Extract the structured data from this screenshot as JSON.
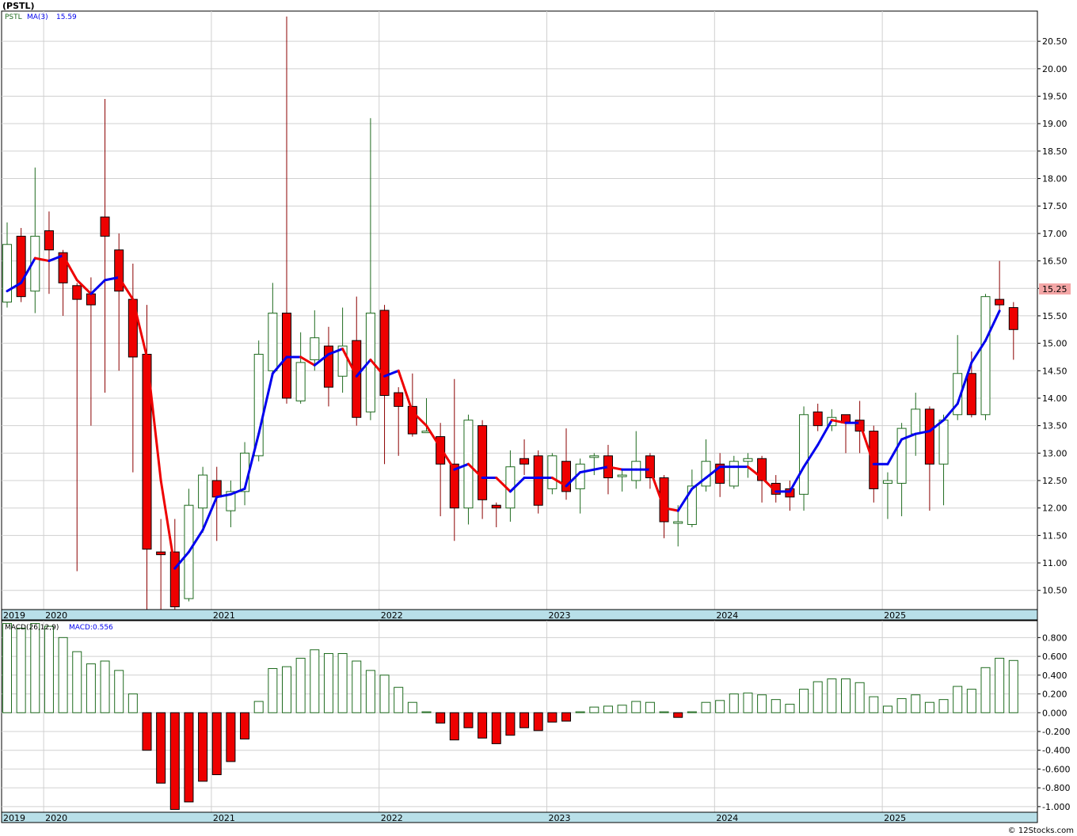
{
  "symbol_title": "(PSTL)",
  "legend": {
    "ticker": "PSTL",
    "ma_label": "MA(3)",
    "ma_value": "15.59",
    "macd_label": "MACD(26,12,9)",
    "macd_value": "MACD:0.556"
  },
  "last_price_label": "15.25",
  "watermark": "© 12Stocks.com",
  "colors": {
    "up": "#1f6b1f",
    "down": "#ee0000",
    "ma_up": "#0000ee",
    "ma_down": "#ee0000",
    "axis_band": "#b8dfe8",
    "grid": "#d0d0d0",
    "price_tag": "#f4a6a6"
  },
  "chart_data": [
    {
      "type": "candlestick",
      "title": "(PSTL)",
      "period": "monthly",
      "ylim": [
        10.15,
        21.05
      ],
      "y_ticks": [
        "10.50",
        "11.00",
        "11.50",
        "12.00",
        "12.50",
        "13.00",
        "13.50",
        "14.00",
        "14.50",
        "15.00",
        "15.50",
        "16.00",
        "16.50",
        "17.00",
        "17.50",
        "18.00",
        "18.50",
        "19.00",
        "19.50",
        "20.00",
        "20.50"
      ],
      "x_labels": [
        "2019",
        "2020",
        "2021",
        "2022",
        "2023",
        "2024",
        "2025"
      ],
      "year_starts": [
        0,
        3,
        15,
        27,
        39,
        51,
        63
      ],
      "candles": [
        [
          15.75,
          16.8,
          15.65,
          17.2
        ],
        [
          16.95,
          15.85,
          15.75,
          17.1
        ],
        [
          15.95,
          16.95,
          15.55,
          18.2
        ],
        [
          17.05,
          16.7,
          15.9,
          17.4
        ],
        [
          16.65,
          16.1,
          15.5,
          16.7
        ],
        [
          16.05,
          15.8,
          10.85,
          16.1
        ],
        [
          15.9,
          15.7,
          13.5,
          16.2
        ],
        [
          17.3,
          16.95,
          14.1,
          19.45
        ],
        [
          16.7,
          15.95,
          14.5,
          17.0
        ],
        [
          15.8,
          14.75,
          12.65,
          16.45
        ],
        [
          14.8,
          11.25,
          10.15,
          15.7
        ],
        [
          11.2,
          11.15,
          10.15,
          11.8
        ],
        [
          11.2,
          10.2,
          10.15,
          11.8
        ],
        [
          10.35,
          12.05,
          10.3,
          12.35
        ],
        [
          12.0,
          12.6,
          11.55,
          12.75
        ],
        [
          12.5,
          12.2,
          11.4,
          12.75
        ],
        [
          11.95,
          12.3,
          11.65,
          12.5
        ],
        [
          12.3,
          13.0,
          12.05,
          13.2
        ],
        [
          12.95,
          14.8,
          12.85,
          15.05
        ],
        [
          14.5,
          15.55,
          14.4,
          16.1
        ],
        [
          15.55,
          14.0,
          13.9,
          20.95
        ],
        [
          13.95,
          14.65,
          13.9,
          15.2
        ],
        [
          14.7,
          15.1,
          14.5,
          15.6
        ],
        [
          14.95,
          14.2,
          13.85,
          15.3
        ],
        [
          14.4,
          14.95,
          14.1,
          15.65
        ],
        [
          15.05,
          13.65,
          13.5,
          15.85
        ],
        [
          13.75,
          15.55,
          13.6,
          19.1
        ],
        [
          15.6,
          14.05,
          12.8,
          15.7
        ],
        [
          14.1,
          13.85,
          12.95,
          14.2
        ],
        [
          13.85,
          13.35,
          13.3,
          14.45
        ],
        [
          13.4,
          13.4,
          13.4,
          14.0
        ],
        [
          13.3,
          12.8,
          11.85,
          13.55
        ],
        [
          12.8,
          12.0,
          11.4,
          14.35
        ],
        [
          12.0,
          13.6,
          11.7,
          13.7
        ],
        [
          13.5,
          12.15,
          11.8,
          13.6
        ],
        [
          12.05,
          12.0,
          11.65,
          12.1
        ],
        [
          12.0,
          12.75,
          11.75,
          13.05
        ],
        [
          12.9,
          12.8,
          12.6,
          13.25
        ],
        [
          12.95,
          12.05,
          11.9,
          13.05
        ],
        [
          12.35,
          12.95,
          12.25,
          13.0
        ],
        [
          12.85,
          12.3,
          12.15,
          13.45
        ],
        [
          12.35,
          12.8,
          11.9,
          12.9
        ],
        [
          12.95,
          12.95,
          12.6,
          13.0
        ],
        [
          12.95,
          12.55,
          12.25,
          13.15
        ],
        [
          12.6,
          12.6,
          12.3,
          12.7
        ],
        [
          12.5,
          12.85,
          12.35,
          13.4
        ],
        [
          12.95,
          12.55,
          12.35,
          13.0
        ],
        [
          12.55,
          11.75,
          11.45,
          12.6
        ],
        [
          11.75,
          11.75,
          11.3,
          12.05
        ],
        [
          11.7,
          12.4,
          11.65,
          12.7
        ],
        [
          12.4,
          12.85,
          12.3,
          13.25
        ],
        [
          12.8,
          12.45,
          12.2,
          13.0
        ],
        [
          12.4,
          12.85,
          12.35,
          12.95
        ],
        [
          12.85,
          12.9,
          12.55,
          13.0
        ],
        [
          12.9,
          12.5,
          12.1,
          12.95
        ],
        [
          12.45,
          12.25,
          12.1,
          12.6
        ],
        [
          12.35,
          12.2,
          11.95,
          12.5
        ],
        [
          12.25,
          13.7,
          11.95,
          13.85
        ],
        [
          13.75,
          13.5,
          13.4,
          13.9
        ],
        [
          13.5,
          13.65,
          13.4,
          13.8
        ],
        [
          13.7,
          13.55,
          13.0,
          13.7
        ],
        [
          13.6,
          13.4,
          13.0,
          13.95
        ],
        [
          13.4,
          12.35,
          12.1,
          13.5
        ],
        [
          12.45,
          12.5,
          11.8,
          12.65
        ],
        [
          12.45,
          13.45,
          11.85,
          13.55
        ],
        [
          13.35,
          13.8,
          12.95,
          14.1
        ],
        [
          13.8,
          12.8,
          11.95,
          13.85
        ],
        [
          12.8,
          13.6,
          12.05,
          13.7
        ],
        [
          13.7,
          14.45,
          13.6,
          15.15
        ],
        [
          14.45,
          13.7,
          13.65,
          14.85
        ],
        [
          13.7,
          15.85,
          13.6,
          15.9
        ],
        [
          15.8,
          15.7,
          15.6,
          16.5
        ],
        [
          15.65,
          15.25,
          14.7,
          15.75
        ]
      ],
      "ma3": [
        15.95,
        16.1,
        16.55,
        16.5,
        16.6,
        16.15,
        15.9,
        16.15,
        16.2,
        15.8,
        14.75,
        12.5,
        10.9,
        11.2,
        11.6,
        12.2,
        12.25,
        12.35,
        13.35,
        14.45,
        14.75,
        14.75,
        14.6,
        14.8,
        14.9,
        14.4,
        14.7,
        14.4,
        14.5,
        13.75,
        13.5,
        13.1,
        12.7,
        12.8,
        12.55,
        12.55,
        12.3,
        12.55,
        12.55,
        12.55,
        12.4,
        12.65,
        12.7,
        12.75,
        12.7,
        12.7,
        12.7,
        12.0,
        11.95,
        12.35,
        12.55,
        12.75,
        12.75,
        12.75,
        12.55,
        12.3,
        12.3,
        12.75,
        13.15,
        13.6,
        13.55,
        13.55,
        12.8,
        12.8,
        13.25,
        13.35,
        13.4,
        13.6,
        13.9,
        14.65,
        15.05,
        15.59
      ]
    },
    {
      "type": "bar",
      "title": "MACD(26,12,9)",
      "current": "MACD:0.556",
      "ylim": [
        -1.06,
        0.98
      ],
      "y_ticks": [
        "0.800",
        "0.600",
        "0.400",
        "0.200",
        "0.000",
        "-0.200",
        "-0.400",
        "-0.600",
        "-0.800",
        "-1.000"
      ],
      "x_labels": [
        "2019",
        "2020",
        "2021",
        "2022",
        "2023",
        "2024",
        "2025"
      ],
      "values": [
        0.95,
        0.9,
        0.95,
        0.92,
        0.8,
        0.65,
        0.52,
        0.55,
        0.45,
        0.2,
        -0.4,
        -0.75,
        -1.03,
        -0.95,
        -0.73,
        -0.66,
        -0.52,
        -0.28,
        0.12,
        0.47,
        0.49,
        0.58,
        0.67,
        0.63,
        0.63,
        0.55,
        0.45,
        0.4,
        0.27,
        0.11,
        0.01,
        -0.11,
        -0.29,
        -0.16,
        -0.27,
        -0.33,
        -0.24,
        -0.16,
        -0.19,
        -0.1,
        -0.09,
        0.01,
        0.06,
        0.07,
        0.08,
        0.12,
        0.11,
        0.01,
        -0.05,
        0.01,
        0.11,
        0.13,
        0.2,
        0.21,
        0.19,
        0.14,
        0.09,
        0.25,
        0.33,
        0.36,
        0.36,
        0.32,
        0.17,
        0.07,
        0.15,
        0.19,
        0.11,
        0.14,
        0.28,
        0.25,
        0.48,
        0.58,
        0.556
      ]
    }
  ]
}
